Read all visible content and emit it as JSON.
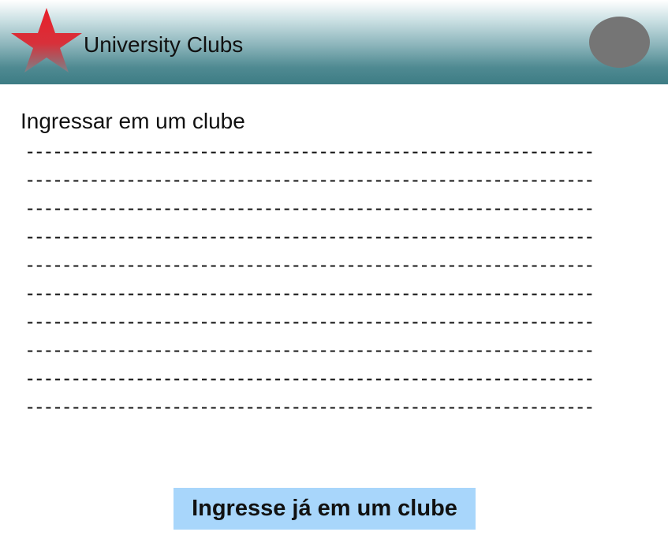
{
  "header": {
    "app_title": "University Clubs",
    "logo_icon": "star-icon",
    "avatar_icon": "user-avatar"
  },
  "main": {
    "page_title": "Ingressar em um clube",
    "text_lines": [
      "--------------------------------------------------------------",
      "--------------------------------------------------------------",
      "--------------------------------------------------------------",
      "--------------------------------------------------------------",
      "--------------------------------------------------------------",
      "--------------------------------------------------------------",
      "--------------------------------------------------------------",
      "--------------------------------------------------------------",
      "--------------------------------------------------------------",
      "--------------------------------------------------------------"
    ],
    "join_button_label": "Ingresse já em um clube"
  },
  "colors": {
    "header_top": "#ffffff",
    "header_bottom": "#3d7c84",
    "star_top": "#e8202a",
    "star_bottom": "#6a7f86",
    "avatar": "#757575",
    "button_background": "#a8d6fb"
  }
}
